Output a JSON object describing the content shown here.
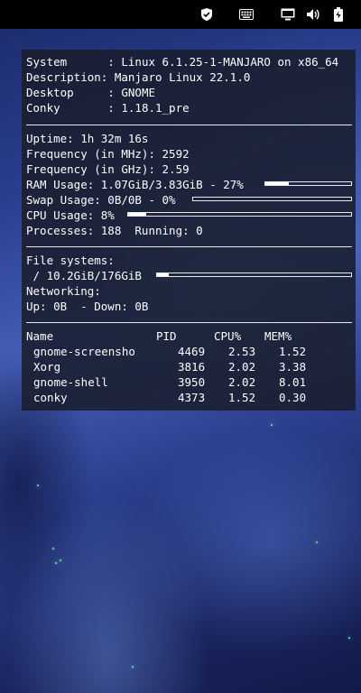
{
  "topbar": {
    "icons": [
      "shield-icon",
      "keyboard-icon",
      "screen-icon",
      "volume-icon",
      "battery-icon"
    ]
  },
  "conky": {
    "system": {
      "rows": [
        {
          "label": "System     ",
          "value": "Linux 6.1.25-1-MANJARO on x86_64"
        },
        {
          "label": "Description",
          "value": "Manjaro Linux 22.1.0"
        },
        {
          "label": "Desktop    ",
          "value": "GNOME"
        },
        {
          "label": "Conky      ",
          "value": "1.18.1_pre"
        }
      ]
    },
    "stats": {
      "uptime": "Uptime: 1h 32m 16s",
      "freq_mhz": "Frequency (in MHz): 2592",
      "freq_ghz": "Frequency (in GHz): 2.59",
      "ram": "RAM Usage: 1.07GiB/3.83GiB - 27%",
      "ram_percent": 27,
      "swap": "Swap Usage: 0B/0B - 0%",
      "swap_percent": 0,
      "cpu": "CPU Usage: 8%",
      "cpu_percent": 8,
      "processes": "Processes: 188  Running: 0"
    },
    "fs": {
      "title": "File systems:",
      "root": " / 10.2GiB/176GiB",
      "root_percent": 6,
      "networking_title": "Networking:",
      "net": "Up: 0B  - Down: 0B"
    },
    "processes": {
      "headers": {
        "name": "Name",
        "pid": "PID",
        "cpu": "CPU%",
        "mem": "MEM%"
      },
      "rows": [
        {
          "name": "gnome-screensho",
          "pid": "4469",
          "cpu": "2.53",
          "mem": "1.52"
        },
        {
          "name": "Xorg",
          "pid": "3816",
          "cpu": "2.02",
          "mem": "3.38"
        },
        {
          "name": "gnome-shell",
          "pid": "3950",
          "cpu": "2.02",
          "mem": "8.01"
        },
        {
          "name": "conky",
          "pid": "4373",
          "cpu": "1.52",
          "mem": "0.30"
        }
      ]
    }
  }
}
